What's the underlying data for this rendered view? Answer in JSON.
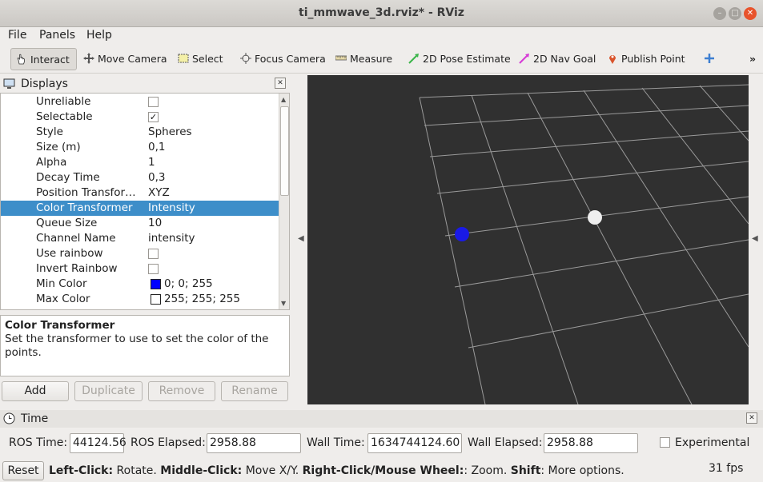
{
  "window": {
    "title": "ti_mmwave_3d.rviz* - RViz"
  },
  "menu": {
    "file": "File",
    "panels": "Panels",
    "help": "Help"
  },
  "toolbar": {
    "interact": "Interact",
    "move_camera": "Move Camera",
    "select": "Select",
    "focus_camera": "Focus Camera",
    "measure": "Measure",
    "pose_estimate": "2D Pose Estimate",
    "nav_goal": "2D Nav Goal",
    "publish_point": "Publish Point",
    "overflow": "»"
  },
  "displays": {
    "title": "Displays",
    "rows": [
      {
        "key": "Unreliable",
        "checked": false
      },
      {
        "key": "Selectable",
        "checked": true
      },
      {
        "key": "Style",
        "value": "Spheres"
      },
      {
        "key": "Size (m)",
        "value": "0,1"
      },
      {
        "key": "Alpha",
        "value": "1"
      },
      {
        "key": "Decay Time",
        "value": "0,3"
      },
      {
        "key": "Position Transfor…",
        "value": "XYZ"
      },
      {
        "key": "Color Transformer",
        "value": "Intensity",
        "selected": true
      },
      {
        "key": "Queue Size",
        "value": "10"
      },
      {
        "key": "Channel Name",
        "value": "intensity"
      },
      {
        "key": "Use rainbow",
        "checked": false
      },
      {
        "key": "Invert Rainbow",
        "checked": false
      },
      {
        "key": "Min Color",
        "value": "0; 0; 255",
        "swatch": "#0000ff"
      },
      {
        "key": "Max Color",
        "value": "255; 255; 255",
        "swatch": "#ffffff"
      }
    ],
    "description_title": "Color Transformer",
    "description_text": "Set the transformer to use to set the color of the points.",
    "buttons": {
      "add": "Add",
      "duplicate": "Duplicate",
      "remove": "Remove",
      "rename": "Rename"
    }
  },
  "viewport": {
    "background": "#303030",
    "grid_color": "#a0a0a0",
    "points": [
      {
        "name": "min-intensity-point",
        "color": "#0000ff"
      },
      {
        "name": "max-intensity-point",
        "color": "#ffffff"
      }
    ]
  },
  "time": {
    "title": "Time",
    "ros_time_label": "ROS Time:",
    "ros_time": "44124.56",
    "ros_elapsed_label": "ROS Elapsed:",
    "ros_elapsed": "2958.88",
    "wall_time_label": "Wall Time:",
    "wall_time": "1634744124.60",
    "wall_elapsed_label": "Wall Elapsed:",
    "wall_elapsed": "2958.88",
    "experimental_label": "Experimental",
    "experimental": false
  },
  "status": {
    "reset": "Reset",
    "left_click_key": "Left-Click:",
    "left_click_text": " Rotate. ",
    "middle_click_key": "Middle-Click:",
    "middle_click_text": " Move X/Y. ",
    "right_click_key": "Right-Click/Mouse Wheel:",
    "right_click_text": ": Zoom. ",
    "shift_key": "Shift",
    "shift_text": ": More options.",
    "fps": "31 fps"
  }
}
